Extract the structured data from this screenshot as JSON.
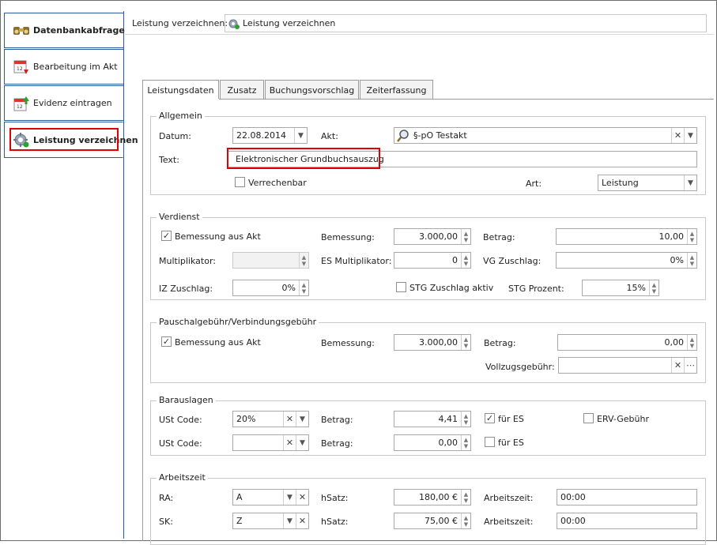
{
  "sidebar": {
    "items": [
      {
        "label": "Datenbankabfrage"
      },
      {
        "label": "Bearbeitung im Akt"
      },
      {
        "label": "Evidenz eintragen"
      },
      {
        "label": "Leistung verzeichnen"
      }
    ]
  },
  "header": {
    "label": "Leistung verzeichnen:",
    "selected": "Leistung verzeichnen"
  },
  "tabs": [
    "Leistungsdaten",
    "Zusatz",
    "Buchungsvorschlag",
    "Zeiterfassung"
  ],
  "allgemein": {
    "title": "Allgemein",
    "datum_label": "Datum:",
    "datum_value": "22.08.2014",
    "akt_label": "Akt:",
    "akt_value": "§-pO Testakt",
    "text_label": "Text:",
    "text_value": "Elektronischer Grundbuchsauszug",
    "verrechenbar_label": "Verrechenbar",
    "art_label": "Art:",
    "art_value": "Leistung"
  },
  "verdienst": {
    "title": "Verdienst",
    "bemessung_aus_akt_label": "Bemessung aus Akt",
    "bemessung_label": "Bemessung:",
    "bemessung_value": "3.000,00",
    "betrag_label": "Betrag:",
    "betrag_value": "10,00",
    "multiplikator_label": "Multiplikator:",
    "multiplikator_value": "",
    "es_multiplikator_label": "ES Multiplikator:",
    "es_multiplikator_value": "0",
    "vg_zuschlag_label": "VG Zuschlag:",
    "vg_zuschlag_value": "0%",
    "iz_zuschlag_label": "IZ Zuschlag:",
    "iz_zuschlag_value": "0%",
    "stg_zuschlag_label": "STG Zuschlag aktiv",
    "stg_prozent_label": "STG Prozent:",
    "stg_prozent_value": "15%"
  },
  "pauschal": {
    "title": "Pauschalgebühr/Verbindungsgebühr",
    "bemessung_aus_akt_label": "Bemessung aus Akt",
    "bemessung_label": "Bemessung:",
    "bemessung_value": "3.000,00",
    "betrag_label": "Betrag:",
    "betrag_value": "0,00",
    "vollzugs_label": "Vollzugsgebühr:",
    "vollzugs_value": ""
  },
  "barauslagen": {
    "title": "Barauslagen",
    "ust1_label": "USt Code:",
    "ust1_value": "20%",
    "betrag1_label": "Betrag:",
    "betrag1_value": "4,41",
    "fuer_es1_label": "für ES",
    "erv_label": "ERV-Gebühr",
    "ust2_label": "USt Code:",
    "ust2_value": "",
    "betrag2_label": "Betrag:",
    "betrag2_value": "0,00",
    "fuer_es2_label": "für ES"
  },
  "arbeitszeit": {
    "title": "Arbeitszeit",
    "ra_label": "RA:",
    "ra_value": "A",
    "hsatz1_label": "hSatz:",
    "hsatz1_value": "180,00 €",
    "az1_label": "Arbeitszeit:",
    "az1_value": "00:00",
    "sk_label": "SK:",
    "sk_value": "Z",
    "hsatz2_label": "hSatz:",
    "hsatz2_value": "75,00 €",
    "az2_label": "Arbeitszeit:",
    "az2_value": "00:00"
  },
  "colors": {
    "highlight": "#e00000",
    "sidebar_border": "#2a5d9f"
  }
}
